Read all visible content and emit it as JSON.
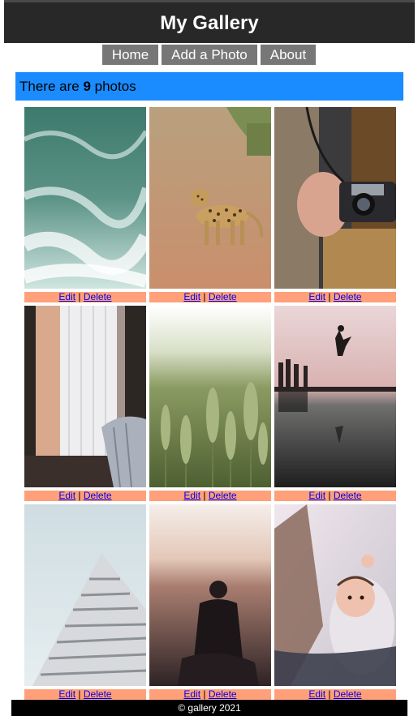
{
  "header": {
    "title": "My Gallery"
  },
  "nav": {
    "items": [
      "Home",
      "Add a Photo",
      "About"
    ]
  },
  "banner": {
    "prefix": "There are ",
    "count": "9",
    "suffix": " photos"
  },
  "photos": [
    {
      "subject": "ocean-waves",
      "edit": "Edit",
      "sep": " | ",
      "delete": "Delete"
    },
    {
      "subject": "leopard-on-dirt-road",
      "edit": "Edit",
      "sep": " | ",
      "delete": "Delete"
    },
    {
      "subject": "hands-holding-camera",
      "edit": "Edit",
      "sep": " | ",
      "delete": "Delete"
    },
    {
      "subject": "curtain-window-chair",
      "edit": "Edit",
      "sep": " | ",
      "delete": "Delete"
    },
    {
      "subject": "wheat-field",
      "edit": "Edit",
      "sep": " | ",
      "delete": "Delete"
    },
    {
      "subject": "jump-over-lake",
      "edit": "Edit",
      "sep": " | ",
      "delete": "Delete"
    },
    {
      "subject": "white-building",
      "edit": "Edit",
      "sep": " | ",
      "delete": "Delete"
    },
    {
      "subject": "person-sunset",
      "edit": "Edit",
      "sep": " | ",
      "delete": "Delete"
    },
    {
      "subject": "baby-lying",
      "edit": "Edit",
      "sep": " | ",
      "delete": "Delete"
    }
  ],
  "footer": {
    "text": "© gallery 2021"
  },
  "colors": {
    "banner": "#1a8cff",
    "nav": "#777777",
    "actions": "#ffa07a",
    "header": "#282828"
  }
}
